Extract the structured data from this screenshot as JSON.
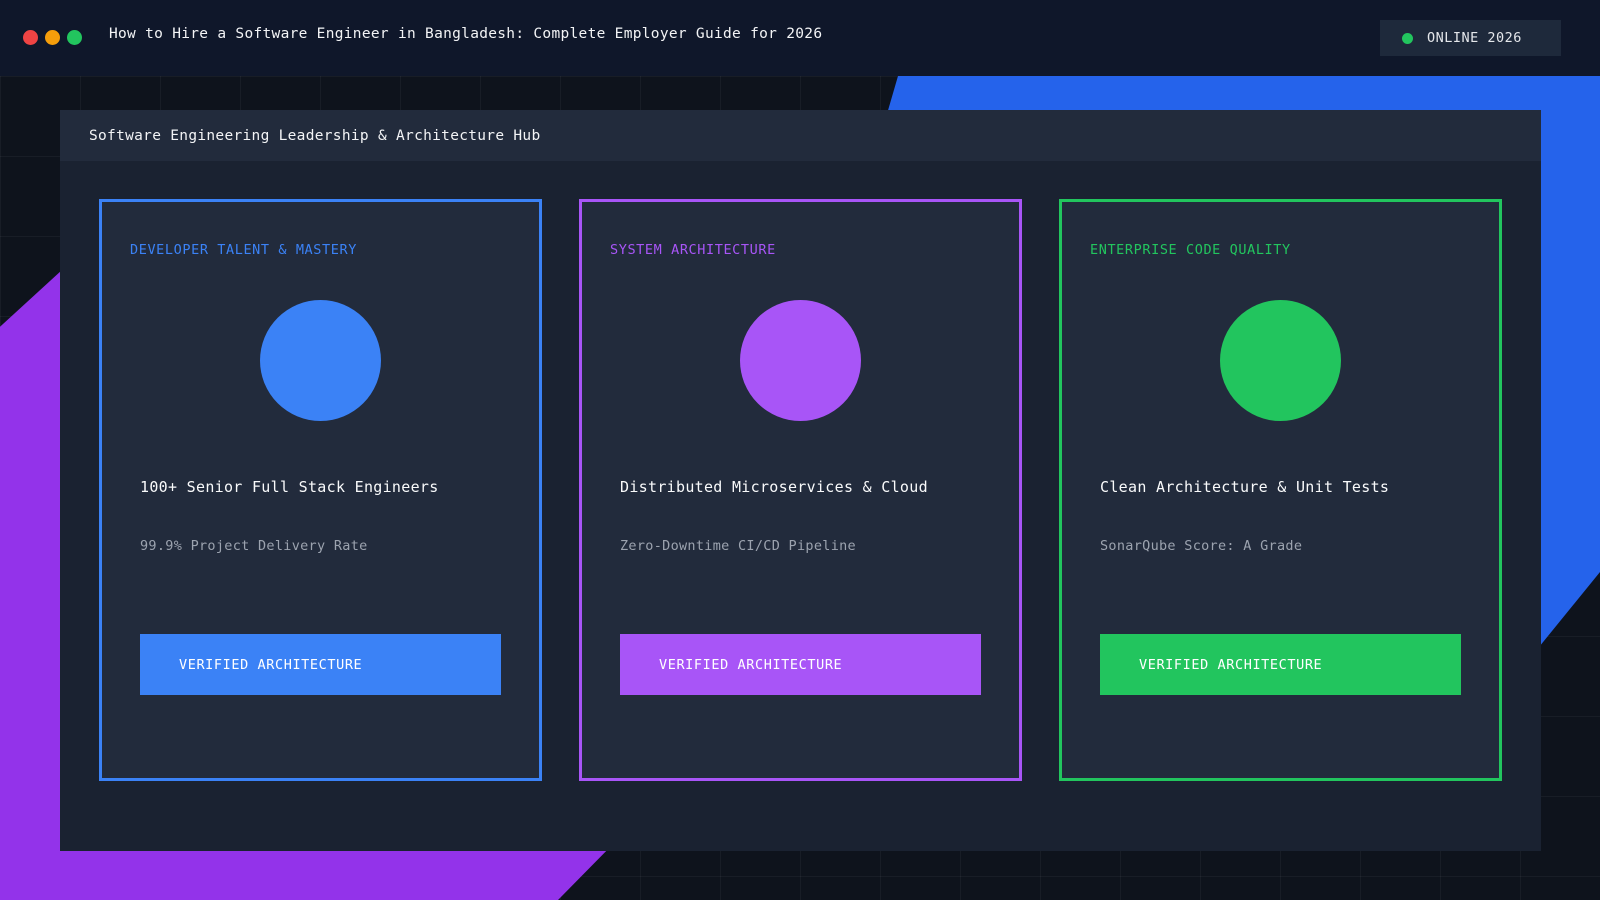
{
  "window": {
    "title": "How to Hire a Software Engineer in Bangladesh: Complete Employer Guide for 2026",
    "controls": [
      {
        "name": "close-window-button",
        "color": "#ef4444"
      },
      {
        "name": "minimize-window-button",
        "color": "#f59e0b"
      },
      {
        "name": "maximize-window-button",
        "color": "#22c55e"
      }
    ]
  },
  "status": {
    "text": "ONLINE 2026",
    "indicator_color": "#22c55e"
  },
  "panel": {
    "title": "Software Engineering Leadership & Architecture Hub"
  },
  "cards": [
    {
      "category": "DEVELOPER TALENT & MASTERY",
      "headline": "100+ Senior Full Stack Engineers",
      "metric": "99.9% Project Delivery Rate",
      "button_label": "VERIFIED ARCHITECTURE",
      "accent": "#3b82f6"
    },
    {
      "category": "SYSTEM ARCHITECTURE",
      "headline": "Distributed Microservices & Cloud",
      "metric": "Zero-Downtime CI/CD Pipeline",
      "button_label": "VERIFIED ARCHITECTURE",
      "accent": "#a855f7"
    },
    {
      "category": "ENTERPRISE CODE QUALITY",
      "headline": "Clean Architecture & Unit Tests",
      "metric": "SonarQube Score: A Grade",
      "button_label": "VERIFIED ARCHITECTURE",
      "accent": "#22c55e"
    }
  ],
  "colors": {
    "background": "#0d1117",
    "titlebar": "#0f172a",
    "panel": "#1a2231",
    "card": "#222b3c",
    "blob_blue": "#2563eb",
    "blob_purple": "#9333ea"
  }
}
